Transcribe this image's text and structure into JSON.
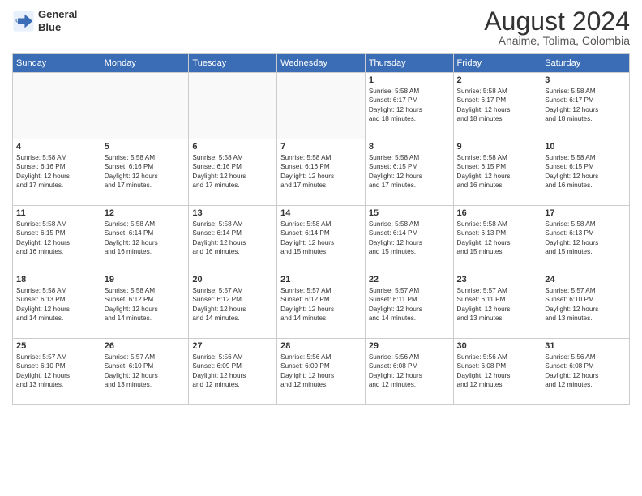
{
  "logo": {
    "line1": "General",
    "line2": "Blue"
  },
  "title": "August 2024",
  "subtitle": "Anaime, Tolima, Colombia",
  "weekdays": [
    "Sunday",
    "Monday",
    "Tuesday",
    "Wednesday",
    "Thursday",
    "Friday",
    "Saturday"
  ],
  "weeks": [
    [
      {
        "day": "",
        "info": ""
      },
      {
        "day": "",
        "info": ""
      },
      {
        "day": "",
        "info": ""
      },
      {
        "day": "",
        "info": ""
      },
      {
        "day": "1",
        "info": "Sunrise: 5:58 AM\nSunset: 6:17 PM\nDaylight: 12 hours\nand 18 minutes."
      },
      {
        "day": "2",
        "info": "Sunrise: 5:58 AM\nSunset: 6:17 PM\nDaylight: 12 hours\nand 18 minutes."
      },
      {
        "day": "3",
        "info": "Sunrise: 5:58 AM\nSunset: 6:17 PM\nDaylight: 12 hours\nand 18 minutes."
      }
    ],
    [
      {
        "day": "4",
        "info": "Sunrise: 5:58 AM\nSunset: 6:16 PM\nDaylight: 12 hours\nand 17 minutes."
      },
      {
        "day": "5",
        "info": "Sunrise: 5:58 AM\nSunset: 6:16 PM\nDaylight: 12 hours\nand 17 minutes."
      },
      {
        "day": "6",
        "info": "Sunrise: 5:58 AM\nSunset: 6:16 PM\nDaylight: 12 hours\nand 17 minutes."
      },
      {
        "day": "7",
        "info": "Sunrise: 5:58 AM\nSunset: 6:16 PM\nDaylight: 12 hours\nand 17 minutes."
      },
      {
        "day": "8",
        "info": "Sunrise: 5:58 AM\nSunset: 6:15 PM\nDaylight: 12 hours\nand 17 minutes."
      },
      {
        "day": "9",
        "info": "Sunrise: 5:58 AM\nSunset: 6:15 PM\nDaylight: 12 hours\nand 16 minutes."
      },
      {
        "day": "10",
        "info": "Sunrise: 5:58 AM\nSunset: 6:15 PM\nDaylight: 12 hours\nand 16 minutes."
      }
    ],
    [
      {
        "day": "11",
        "info": "Sunrise: 5:58 AM\nSunset: 6:15 PM\nDaylight: 12 hours\nand 16 minutes."
      },
      {
        "day": "12",
        "info": "Sunrise: 5:58 AM\nSunset: 6:14 PM\nDaylight: 12 hours\nand 16 minutes."
      },
      {
        "day": "13",
        "info": "Sunrise: 5:58 AM\nSunset: 6:14 PM\nDaylight: 12 hours\nand 16 minutes."
      },
      {
        "day": "14",
        "info": "Sunrise: 5:58 AM\nSunset: 6:14 PM\nDaylight: 12 hours\nand 15 minutes."
      },
      {
        "day": "15",
        "info": "Sunrise: 5:58 AM\nSunset: 6:14 PM\nDaylight: 12 hours\nand 15 minutes."
      },
      {
        "day": "16",
        "info": "Sunrise: 5:58 AM\nSunset: 6:13 PM\nDaylight: 12 hours\nand 15 minutes."
      },
      {
        "day": "17",
        "info": "Sunrise: 5:58 AM\nSunset: 6:13 PM\nDaylight: 12 hours\nand 15 minutes."
      }
    ],
    [
      {
        "day": "18",
        "info": "Sunrise: 5:58 AM\nSunset: 6:13 PM\nDaylight: 12 hours\nand 14 minutes."
      },
      {
        "day": "19",
        "info": "Sunrise: 5:58 AM\nSunset: 6:12 PM\nDaylight: 12 hours\nand 14 minutes."
      },
      {
        "day": "20",
        "info": "Sunrise: 5:57 AM\nSunset: 6:12 PM\nDaylight: 12 hours\nand 14 minutes."
      },
      {
        "day": "21",
        "info": "Sunrise: 5:57 AM\nSunset: 6:12 PM\nDaylight: 12 hours\nand 14 minutes."
      },
      {
        "day": "22",
        "info": "Sunrise: 5:57 AM\nSunset: 6:11 PM\nDaylight: 12 hours\nand 14 minutes."
      },
      {
        "day": "23",
        "info": "Sunrise: 5:57 AM\nSunset: 6:11 PM\nDaylight: 12 hours\nand 13 minutes."
      },
      {
        "day": "24",
        "info": "Sunrise: 5:57 AM\nSunset: 6:10 PM\nDaylight: 12 hours\nand 13 minutes."
      }
    ],
    [
      {
        "day": "25",
        "info": "Sunrise: 5:57 AM\nSunset: 6:10 PM\nDaylight: 12 hours\nand 13 minutes."
      },
      {
        "day": "26",
        "info": "Sunrise: 5:57 AM\nSunset: 6:10 PM\nDaylight: 12 hours\nand 13 minutes."
      },
      {
        "day": "27",
        "info": "Sunrise: 5:56 AM\nSunset: 6:09 PM\nDaylight: 12 hours\nand 12 minutes."
      },
      {
        "day": "28",
        "info": "Sunrise: 5:56 AM\nSunset: 6:09 PM\nDaylight: 12 hours\nand 12 minutes."
      },
      {
        "day": "29",
        "info": "Sunrise: 5:56 AM\nSunset: 6:08 PM\nDaylight: 12 hours\nand 12 minutes."
      },
      {
        "day": "30",
        "info": "Sunrise: 5:56 AM\nSunset: 6:08 PM\nDaylight: 12 hours\nand 12 minutes."
      },
      {
        "day": "31",
        "info": "Sunrise: 5:56 AM\nSunset: 6:08 PM\nDaylight: 12 hours\nand 12 minutes."
      }
    ]
  ]
}
